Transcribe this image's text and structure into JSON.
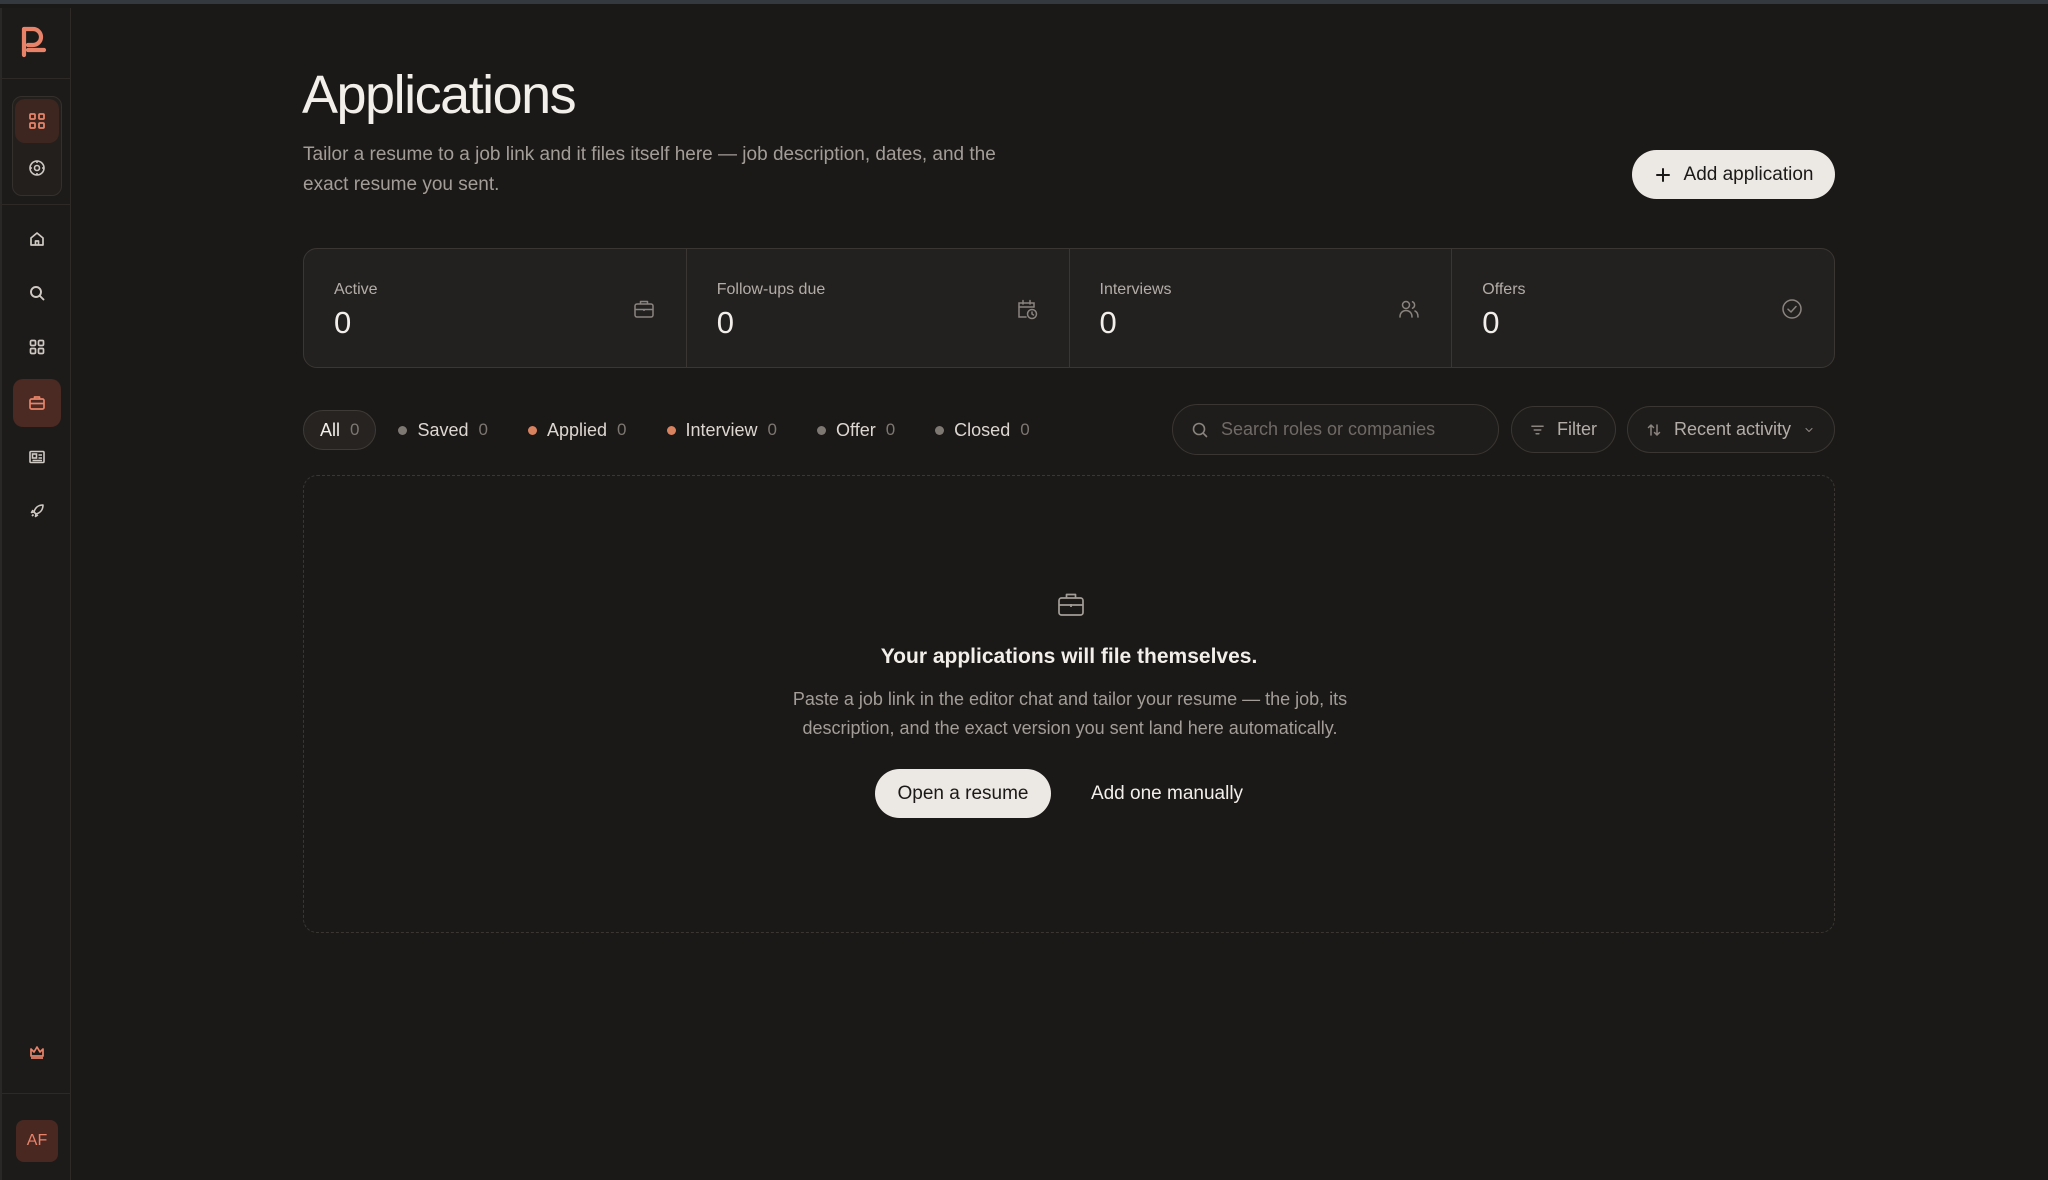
{
  "sidebar": {
    "logo_icon": "brand-logo",
    "workspace_items": [
      {
        "icon": "grid-icon",
        "active": true
      },
      {
        "icon": "settings-cog-icon",
        "active": false
      }
    ],
    "nav_items": [
      {
        "icon": "home-icon"
      },
      {
        "icon": "search-icon"
      },
      {
        "icon": "apps-grid-icon"
      },
      {
        "icon": "briefcase-icon",
        "active": true
      },
      {
        "icon": "id-card-icon"
      },
      {
        "icon": "rocket-icon"
      }
    ],
    "bottom_icon": "crown-icon",
    "avatar_initials": "AF"
  },
  "header": {
    "title": "Applications",
    "subtitle": "Tailor a resume to a job link and it files itself here — job description, dates, and the exact resume you sent.",
    "add_button_label": "Add application"
  },
  "stats": [
    {
      "label": "Active",
      "value": "0",
      "icon": "briefcase-icon"
    },
    {
      "label": "Follow-ups due",
      "value": "0",
      "icon": "calendar-clock-icon"
    },
    {
      "label": "Interviews",
      "value": "0",
      "icon": "users-icon"
    },
    {
      "label": "Offers",
      "value": "0",
      "icon": "check-circle-icon"
    }
  ],
  "filters": {
    "chips": [
      {
        "label": "All",
        "count": "0",
        "dot": null
      },
      {
        "label": "Saved",
        "count": "0",
        "dot": "#7e7872"
      },
      {
        "label": "Applied",
        "count": "0",
        "dot": "#d9825f"
      },
      {
        "label": "Interview",
        "count": "0",
        "dot": "#d9825f"
      },
      {
        "label": "Offer",
        "count": "0",
        "dot": "#7e7872"
      },
      {
        "label": "Closed",
        "count": "0",
        "dot": "#7e7872"
      }
    ],
    "search_placeholder": "Search roles or companies",
    "filter_label": "Filter",
    "sort_label": "Recent activity"
  },
  "empty_state": {
    "title": "Your applications will file themselves.",
    "description": "Paste a job link in the editor chat and tailor your resume — the job, its description, and the exact version you sent land here automatically.",
    "primary_label": "Open a resume",
    "secondary_label": "Add one manually"
  },
  "colors": {
    "accent": "#e8836a",
    "background": "#1b1917"
  }
}
